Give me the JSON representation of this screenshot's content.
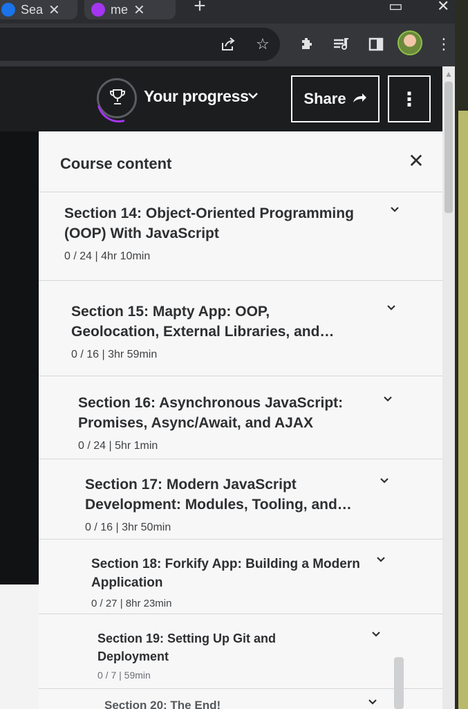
{
  "browser": {
    "tabs": [
      {
        "label": "Sea",
        "favicon_color": "#1a73e8"
      },
      {
        "label": "me",
        "favicon_color": "#a435f0"
      }
    ],
    "new_tab_glyph": "+",
    "window": {
      "minimize_glyph": "▭",
      "close_glyph": "✕"
    },
    "toolbar_icons": [
      "share-icon",
      "star-icon",
      "extensions-icon",
      "reading-list-icon",
      "side-panel-icon",
      "profile-avatar",
      "menu-icon"
    ]
  },
  "header": {
    "progress_label": "Your progress",
    "share_label": "Share",
    "more_glyph": "⋮",
    "accent_color": "#a435f0"
  },
  "sidebar": {
    "title": "Course content",
    "close_glyph": "✕",
    "sections": [
      {
        "title": "Section 14: Object-Oriented Programming (OOP) With JavaScript",
        "meta": "0 / 24 | 4hr 10min"
      },
      {
        "title": "Section 15: Mapty App: OOP, Geolocation, External Libraries, and…",
        "meta": "0 / 16 | 3hr 59min"
      },
      {
        "title": "Section 16: Asynchronous JavaScript: Promises, Async/Await, and AJAX",
        "meta": "0 / 24 | 5hr 1min"
      },
      {
        "title": "Section 17: Modern JavaScript Development: Modules, Tooling, and…",
        "meta": "0 / 16 | 3hr 50min"
      },
      {
        "title": "Section 18: Forkify App: Building a Modern Application",
        "meta": "0 / 27 | 8hr 23min"
      },
      {
        "title": "Section 19: Setting Up Git and Deployment",
        "meta": "0 / 7 | 59min"
      },
      {
        "title": "Section 20: The End!",
        "meta": ""
      }
    ]
  }
}
